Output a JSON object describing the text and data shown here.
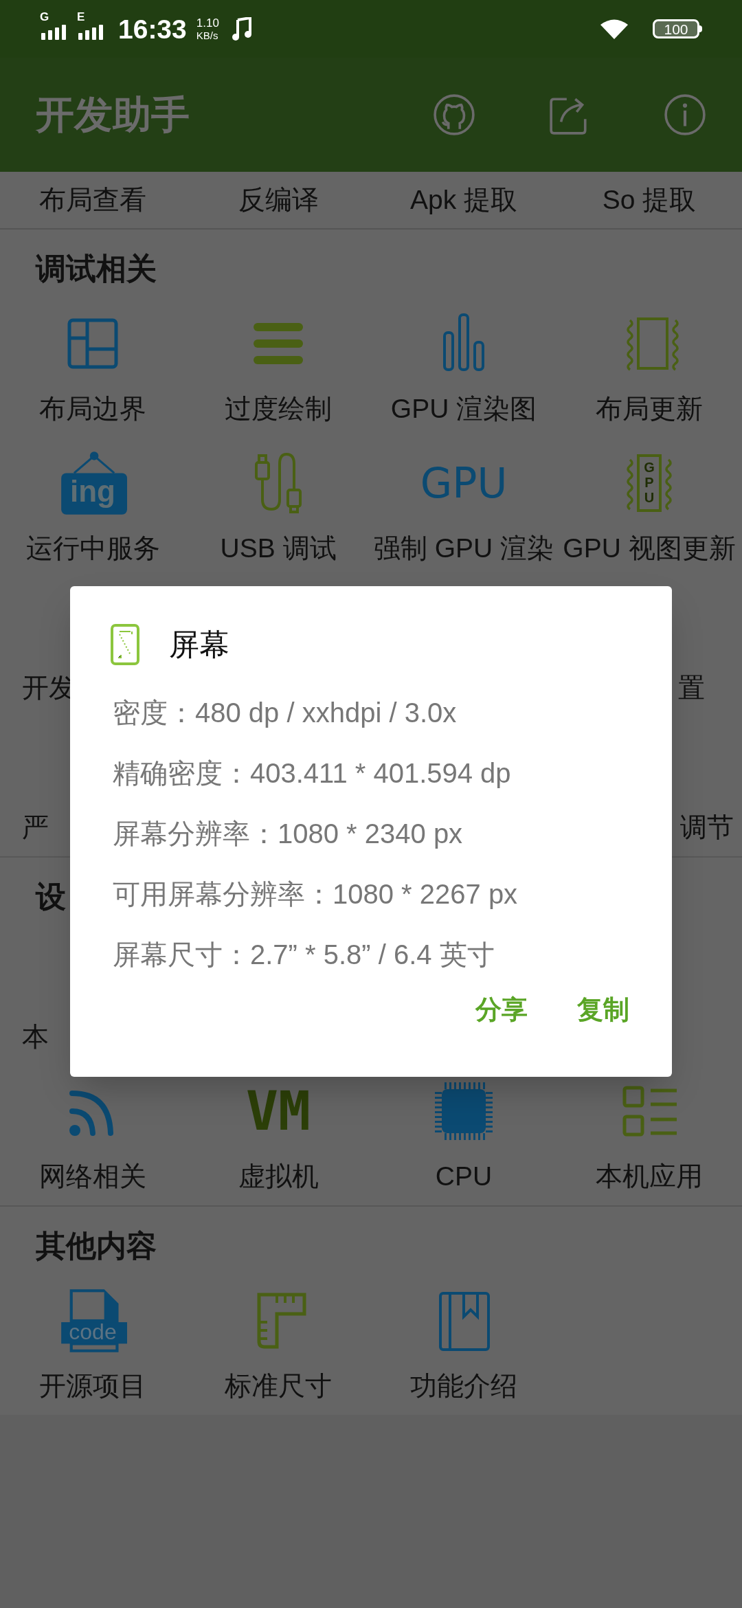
{
  "status_bar": {
    "signal_1": "G",
    "signal_2": "E",
    "time": "16:33",
    "speed_value": "1.10",
    "speed_unit": "KB/s",
    "battery": "100"
  },
  "app_bar": {
    "title": "开发助手"
  },
  "tools": [
    "布局查看",
    "反编译",
    "Apk 提取",
    "So 提取"
  ],
  "sections": [
    {
      "title": "调试相关",
      "items": [
        {
          "label": "布局边界"
        },
        {
          "label": "过度绘制"
        },
        {
          "label": "GPU 渲染图"
        },
        {
          "label": "布局更新"
        },
        {
          "label": "运行中服务",
          "icon_text": "ing"
        },
        {
          "label": "USB 调试"
        },
        {
          "label": "强制 GPU 渲染",
          "icon_text": "GPU"
        },
        {
          "label": "GPU 视图更新",
          "icon_text": "GPU"
        }
      ],
      "partial_rows": [
        {
          "left": "开发",
          "right": "置"
        },
        {
          "left": "严",
          "right": "调节"
        }
      ]
    },
    {
      "title": "设",
      "partial_rows": [
        {
          "left": "本"
        }
      ],
      "items": [
        {
          "label": "网络相关"
        },
        {
          "label": "虚拟机",
          "icon_text": "VM"
        },
        {
          "label": "CPU"
        },
        {
          "label": "本机应用"
        }
      ]
    },
    {
      "title": "其他内容",
      "items": [
        {
          "label": "开源项目",
          "icon_text": "code"
        },
        {
          "label": "标准尺寸"
        },
        {
          "label": "功能介绍"
        }
      ]
    }
  ],
  "dialog": {
    "title": "屏幕",
    "lines": [
      "密度：480 dp / xxhdpi / 3.0x",
      "精确密度：403.411 * 401.594 dp",
      "屏幕分辨率：1080 * 2340 px",
      "可用屏幕分辨率：1080 * 2267 px",
      "屏幕尺寸：2.7” * 5.8” / 6.4 英寸"
    ],
    "buttons": [
      "分享",
      "复制"
    ]
  }
}
